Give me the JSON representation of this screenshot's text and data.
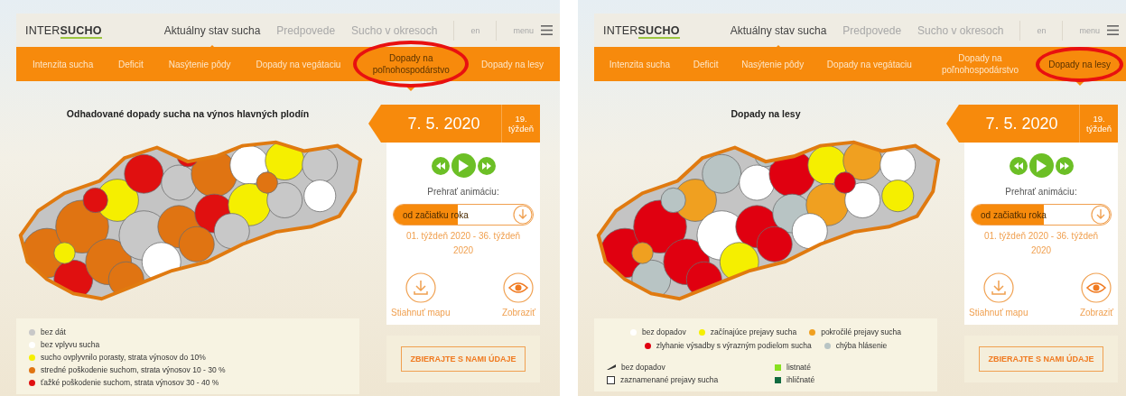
{
  "panels": [
    {
      "header": {
        "logo": "INTER**SUCHO**",
        "nav": [
          {
            "label": "Aktuálny stav sucha",
            "selected": true
          },
          {
            "label": "Predpovede",
            "selected": false
          },
          {
            "label": "Sucho v okresoch",
            "selected": false
          }
        ],
        "language": "en",
        "menu": "menu"
      },
      "subnav": [
        {
          "label": "Intenzita sucha",
          "selected": false
        },
        {
          "label": "Deficit",
          "selected": false
        },
        {
          "label": "Nasýtenie pôdy",
          "selected": false
        },
        {
          "label": "Dopady na vegátaciu",
          "selected": false
        },
        {
          "label": "Dopady na poľnohospodárstvo",
          "selected": true
        },
        {
          "label": "Dopady na lesy",
          "selected": false
        }
      ],
      "map_title": "Odhadované dopady sucha na výnos hlavných plodín",
      "legend": {
        "kind": "list",
        "items": [
          {
            "label": "bez dát",
            "color": "#c8c8c8"
          },
          {
            "label": "bez vplyvu sucha",
            "color": "#ffffff"
          },
          {
            "label": "sucho ovplyvnilo porasty, strata výnosov do 10%",
            "color": "#f5ef00"
          },
          {
            "label": "stredné poškodenie suchom, strata výnosov 10 - 30 %",
            "color": "#e07412"
          },
          {
            "label": "ťažké poškodenie suchom, strata výnosov 30 - 40 %",
            "color": "#e01010"
          }
        ]
      },
      "date": "7. 5. 2020",
      "week_number": "19.",
      "week_label": "týždeň",
      "animation_label": "Prehrať animáciu:",
      "period": {
        "value": "od začiatku roka",
        "level": 0.46
      },
      "range": "01. týždeň 2020 - 36. týždeň 2020",
      "actions": [
        "Stiahnuť mapu",
        "Zobraziť"
      ],
      "collect_button": "ZBIERAJTE S NAMI ÚDAJE"
    },
    {
      "header": {
        "logo": "INTER**SUCHO**",
        "nav": [
          {
            "label": "Aktuálny stav sucha",
            "selected": true
          },
          {
            "label": "Predpovede",
            "selected": false
          },
          {
            "label": "Sucho v okresoch",
            "selected": false
          }
        ],
        "language": "en",
        "menu": "menu"
      },
      "subnav": [
        {
          "label": "Intenzita sucha",
          "selected": false
        },
        {
          "label": "Deficit",
          "selected": false
        },
        {
          "label": "Nasýtenie pôdy",
          "selected": false
        },
        {
          "label": "Dopady na vegátaciu",
          "selected": false
        },
        {
          "label": "Dopady na poľnohospodárstvo",
          "selected": false
        },
        {
          "label": "Dopady na lesy",
          "selected": true
        }
      ],
      "map_title": "Dopady na lesy",
      "legend": {
        "kind": "inline",
        "items": [
          {
            "label": "bez dopadov",
            "color": "#ffffff"
          },
          {
            "label": "začínajúce prejavy sucha",
            "color": "#f5ef00"
          },
          {
            "label": "pokročilé prejavy sucha",
            "color": "#f0a020"
          },
          {
            "label": "zlyhanie výsadby s výrazným podielom sucha",
            "color": "#e00010"
          },
          {
            "label": "chýba hlásenie",
            "color": "#b8c4c4"
          }
        ]
      },
      "legend_2": [
        {
          "kind": "line",
          "label": "bez dopadov"
        },
        {
          "kind": "square",
          "label": "listnaté",
          "color": "#88e020"
        },
        {
          "kind": "outline",
          "label": "zaznamenané prejavy sucha"
        },
        {
          "kind": "square",
          "label": "ihličnaté",
          "color": "#106a40"
        }
      ],
      "date": "7. 5. 2020",
      "week_number": "19.",
      "week_label": "týždeň",
      "animation_label": "Prehrať animáciu:",
      "period": {
        "value": "od začiatku roka",
        "level": 0.52
      },
      "range": "01. týždeň 2020 - 36. týždeň 2020",
      "actions": [
        "Stiahnuť mapu",
        "Zobraziť"
      ],
      "collect_button": "ZBIERAJTE S NAMI ÚDAJE"
    }
  ]
}
